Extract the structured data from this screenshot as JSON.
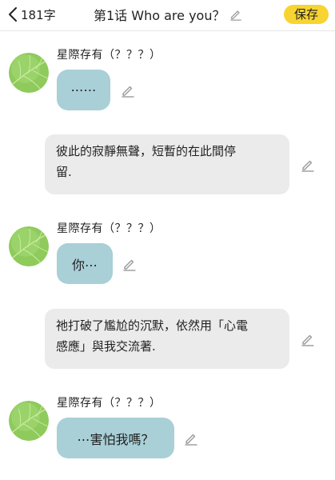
{
  "header": {
    "back_count": "181字",
    "title": "第1话 Who are you？",
    "save_label": "保存"
  },
  "messages": [
    {
      "type": "character",
      "speaker": "星際存有（？？？）",
      "text": "⋯⋯"
    },
    {
      "type": "narration",
      "text": "彼此的寂靜無聲，短暫的在此間停\n留."
    },
    {
      "type": "character",
      "speaker": "星際存有（？？？）",
      "text": "你⋯"
    },
    {
      "type": "narration",
      "text": "祂打破了尷尬的沉默，依然用「心電\n感應」與我交流著."
    },
    {
      "type": "character",
      "speaker": "星際存有（？？？）",
      "text": "⋯害怕我嗎？"
    }
  ],
  "colors": {
    "accent": "#f8d432",
    "character_bubble": "#a9cfd7",
    "narration_bubble": "#ebebeb",
    "avatar": "#8fca5c",
    "edit_icon": "#9a9a9a"
  },
  "icons": [
    "back-chevron-icon",
    "pencil-icon",
    "leaf-avatar-icon"
  ]
}
